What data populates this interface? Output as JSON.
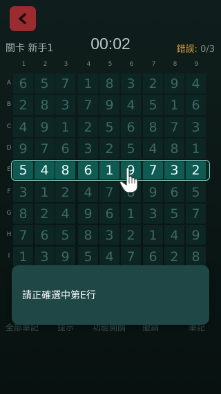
{
  "header": {
    "level": "關卡 新手1",
    "timer": "00:02",
    "errors_label": "錯誤:",
    "errors_count": "0/3"
  },
  "columns": [
    "1",
    "2",
    "3",
    "4",
    "5",
    "6",
    "7",
    "8",
    "9"
  ],
  "rows": [
    "A",
    "B",
    "C",
    "D",
    "E",
    "F",
    "G",
    "H",
    "I"
  ],
  "grid": [
    [
      "6",
      "5",
      "7",
      "1",
      "8",
      "3",
      "2",
      "9",
      "4"
    ],
    [
      "2",
      "8",
      "3",
      "7",
      "9",
      "4",
      "5",
      "1",
      "6"
    ],
    [
      "4",
      "9",
      "1",
      "2",
      "5",
      "6",
      "8",
      "7",
      "3"
    ],
    [
      "9",
      "7",
      "6",
      "3",
      "2",
      "5",
      "4",
      "8",
      "1"
    ],
    [
      "5",
      "4",
      "8",
      "6",
      "1",
      "9",
      "7",
      "3",
      "2"
    ],
    [
      "3",
      "1",
      "2",
      "4",
      "7",
      "8",
      "9",
      "6",
      "5"
    ],
    [
      "8",
      "2",
      "4",
      "9",
      "6",
      "1",
      "3",
      "5",
      "7"
    ],
    [
      "7",
      "6",
      "5",
      "8",
      "3",
      "2",
      "1",
      "4",
      "9"
    ],
    [
      "1",
      "3",
      "9",
      "5",
      "4",
      "7",
      "6",
      "2",
      "8"
    ]
  ],
  "highlighted_row": "E",
  "toolbar": [
    "全部筆記",
    "提示",
    "功能開關",
    "撤銷",
    "筆記"
  ],
  "toast": "請正確選中第E行",
  "icons": {
    "back": "chevron-left-icon",
    "pointer": "tap-hand-icon"
  },
  "colors": {
    "accent": "#7fd2c2",
    "back_button": "#9b2b2e",
    "errors": "#d39a3a"
  }
}
